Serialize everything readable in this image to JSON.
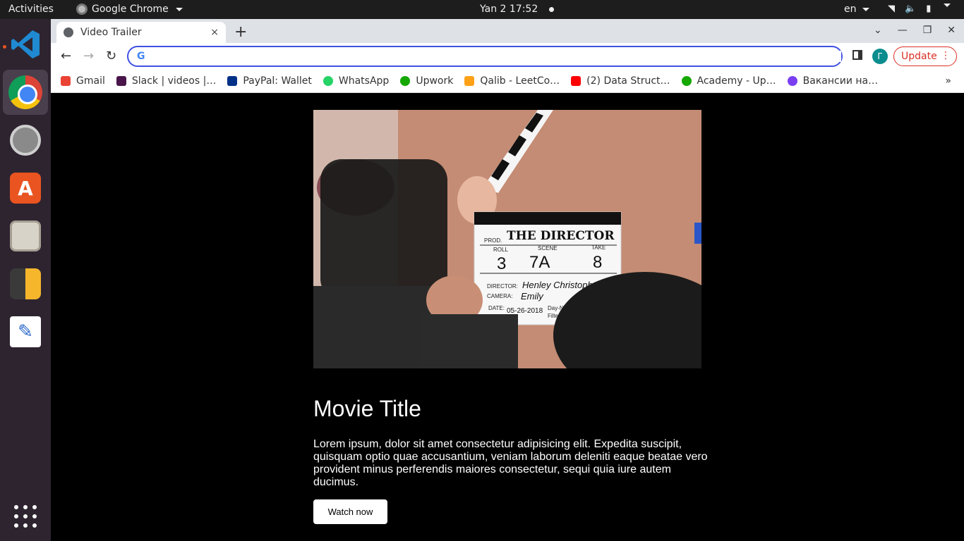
{
  "system": {
    "activities": "Activities",
    "app_name": "Google Chrome",
    "clock": "Yan 2  17:52",
    "language": "en"
  },
  "browser": {
    "tab_title": "Video Trailer",
    "tab_close": "×",
    "new_tab": "+",
    "omnibox_value": "",
    "avatar_letter": "Г",
    "update_label": "Update",
    "accent_color": "#3f51e0",
    "update_color": "#d93025"
  },
  "bookmarks": [
    {
      "label": "Gmail",
      "icon": "gmail-icon",
      "color": "#ea4335"
    },
    {
      "label": "Slack | videos |…",
      "icon": "slack-icon",
      "color": "#4a154b"
    },
    {
      "label": "PayPal: Wallet",
      "icon": "paypal-icon",
      "color": "#003087"
    },
    {
      "label": "WhatsApp",
      "icon": "whatsapp-icon",
      "color": "#25d366"
    },
    {
      "label": "Upwork",
      "icon": "upwork-icon",
      "color": "#14a800"
    },
    {
      "label": "Qalib - LeetCo…",
      "icon": "leetcode-icon",
      "color": "#ffa116"
    },
    {
      "label": "(2) Data Struct…",
      "icon": "youtube-icon",
      "color": "#ff0000"
    },
    {
      "label": "Academy - Up…",
      "icon": "upwork-icon",
      "color": "#14a800"
    },
    {
      "label": "Вакансии на…",
      "icon": "djinni-icon",
      "color": "#7a3ff2"
    }
  ],
  "bookmarks_more": "»",
  "page": {
    "title": "Movie Title",
    "description": "Lorem ipsum, dolor sit amet consectetur adipisicing elit. Expedita suscipit, quisquam optio quae accusantium, veniam laborum deleniti eaque beatae vero provident minus perferendis maiores consectetur, sequi quia iure autem ducimus.",
    "button_label": "Watch now",
    "clapperboard": {
      "heading": "THE DIRECTOR",
      "prod_label": "PROD.",
      "roll_label": "ROLL",
      "scene_label": "SCENE",
      "take_label": "TAKE",
      "roll": "3",
      "scene": "7A",
      "take": "8",
      "director_label": "DIRECTOR:",
      "director": "Henley Christopher",
      "camera_label": "CAMERA:",
      "camera": "Emily",
      "date_label": "DATE:",
      "date": "05-26-2018",
      "daynight": "Day-Night Int",
      "filter": "Filter"
    }
  }
}
